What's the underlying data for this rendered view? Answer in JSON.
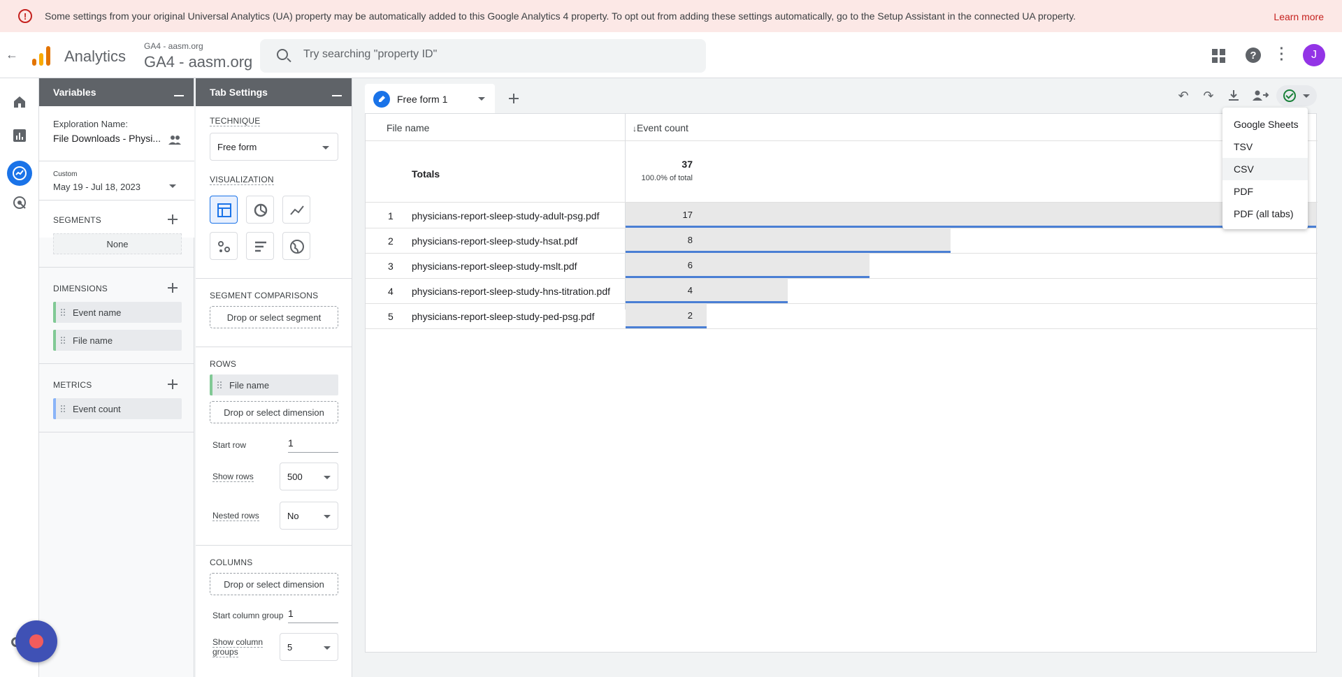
{
  "banner": {
    "message": "Some settings from your original Universal Analytics (UA) property may be automatically added to this Google Analytics 4 property. To opt out from adding these settings automatically, go to the Setup Assistant in the connected UA property.",
    "link": "Learn more",
    "color": "#c5221f"
  },
  "header": {
    "product": "Analytics",
    "property_small": "GA4 - aasm.org",
    "property_large": "GA4 - aasm.org",
    "search_placeholder": "Try searching \"property ID\"",
    "avatar_initial": "J",
    "avatar_color": "#9334e6"
  },
  "variables": {
    "title": "Variables",
    "exploration_label": "Exploration Name:",
    "exploration_name": "File Downloads - Physi...",
    "date_tag": "Custom",
    "date_range": "May 19 - Jul 18, 2023",
    "segments_label": "SEGMENTS",
    "segments_none": "None",
    "dimensions_label": "DIMENSIONS",
    "dimensions": [
      "Event name",
      "File name"
    ],
    "metrics_label": "METRICS",
    "metrics": [
      "Event count"
    ]
  },
  "tab_settings": {
    "title": "Tab Settings",
    "technique_label": "TECHNIQUE",
    "technique_value": "Free form",
    "visualization_label": "VISUALIZATION",
    "segment_comparisons_label": "SEGMENT COMPARISONS",
    "segment_drop": "Drop or select segment",
    "rows_label": "ROWS",
    "rows_chip": "File name",
    "rows_drop": "Drop or select dimension",
    "start_row_label": "Start row",
    "start_row_value": "1",
    "show_rows_label": "Show rows",
    "show_rows_value": "500",
    "nested_rows_label": "Nested rows",
    "nested_rows_value": "No",
    "columns_label": "COLUMNS",
    "columns_drop": "Drop or select dimension",
    "start_col_label": "Start column group",
    "start_col_value": "1",
    "show_col_label_1": "Show column",
    "show_col_label_2": "groups",
    "show_col_value": "5"
  },
  "canvas": {
    "tab_name": "Free form 1",
    "col_dimension": "File name",
    "col_metric": "Event count",
    "sort_indicator": "↓",
    "totals_label": "Totals",
    "totals_value": "37",
    "totals_pct": "100.0% of total",
    "rows": [
      {
        "idx": "1",
        "name": "physicians-report-sleep-study-adult-psg.pdf",
        "value": 17
      },
      {
        "idx": "2",
        "name": "physicians-report-sleep-study-hsat.pdf",
        "value": 8
      },
      {
        "idx": "3",
        "name": "physicians-report-sleep-study-mslt.pdf",
        "value": 6
      },
      {
        "idx": "4",
        "name": "physicians-report-sleep-study-hns-titration.pdf",
        "value": 4
      },
      {
        "idx": "5",
        "name": "physicians-report-sleep-study-ped-psg.pdf",
        "value": 2
      }
    ],
    "bar_color": "#4a7fd4"
  },
  "export_menu": {
    "items": [
      "Google Sheets",
      "TSV",
      "CSV",
      "PDF",
      "PDF (all tabs)"
    ],
    "highlighted": "CSV"
  },
  "icons": {
    "toolbar": [
      "undo-icon",
      "redo-icon",
      "download-icon",
      "share-icon",
      "saved-check-icon"
    ]
  }
}
